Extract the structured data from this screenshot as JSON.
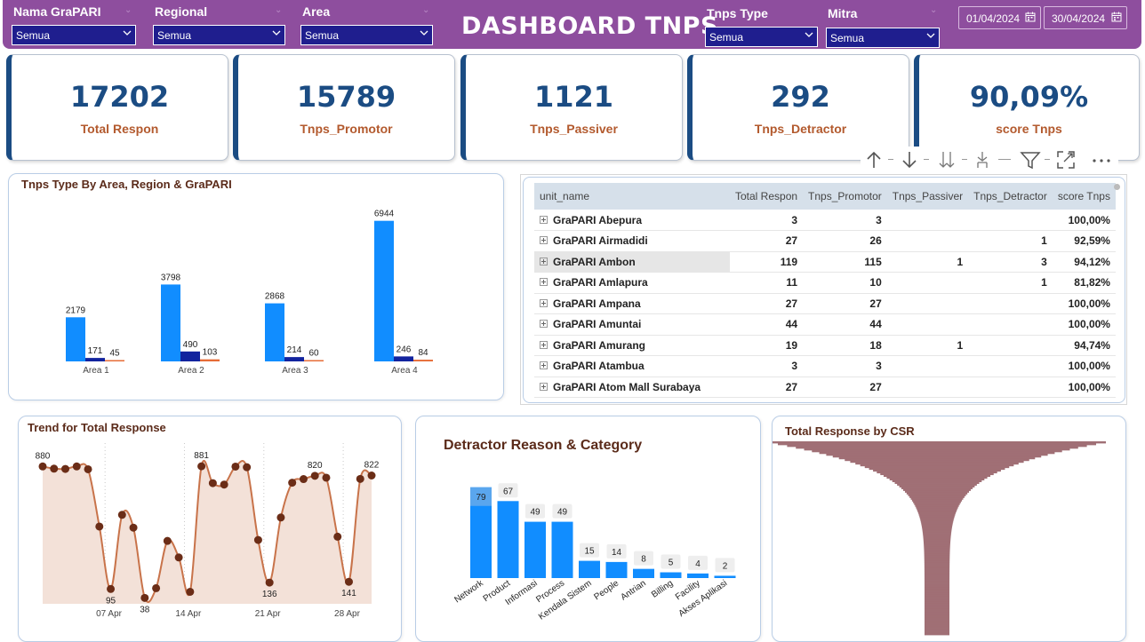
{
  "header": {
    "title": "DASHBOARD TNPS",
    "filters": [
      {
        "label": "Nama GraPARI",
        "value": "Semua"
      },
      {
        "label": "Regional",
        "value": "Semua"
      },
      {
        "label": "Area",
        "value": "Semua"
      },
      {
        "label": "Tnps Type",
        "value": "Semua"
      },
      {
        "label": "Mitra",
        "value": "Semua"
      }
    ],
    "date_start": "01/04/2024",
    "date_end": "30/04/2024"
  },
  "kpis": [
    {
      "value": "17202",
      "label": "Total Respon"
    },
    {
      "value": "15789",
      "label": "Tnps_Promotor"
    },
    {
      "value": "1121",
      "label": "Tnps_Passiver"
    },
    {
      "value": "292",
      "label": "Tnps_Detractor"
    },
    {
      "value": "90,09%",
      "label": "score Tnps"
    }
  ],
  "colors": {
    "header_bg": "#8e4e9e",
    "kpi_value": "#1b4c83",
    "kpi_label": "#b35a2e",
    "promotor": "#118dff",
    "passiver": "#12239e",
    "detractor": "#e66c37",
    "trend_line": "#c8734a",
    "trend_point": "#6b2d17",
    "trend_fill": "#f3e1d8",
    "csr_fill": "#a06f75"
  },
  "toolbar": {
    "icons": [
      "arrow-up-icon",
      "arrow-down-icon",
      "double-arrow-down-icon",
      "expand-hierarchy-icon",
      "filter-icon",
      "focus-mode-icon",
      "more-options-icon"
    ]
  },
  "area_chart": {
    "title": "Tnps Type By Area, Region & GraPARI"
  },
  "table": {
    "columns": [
      "unit_name",
      "Total Respon",
      "Tnps_Promotor",
      "Tnps_Passiver",
      "Tnps_Detractor",
      "score Tnps"
    ],
    "rows": [
      [
        "GraPARI Abepura",
        "3",
        "3",
        "",
        "",
        "100,00%"
      ],
      [
        "GraPARI Airmadidi",
        "27",
        "26",
        "",
        "1",
        "92,59%"
      ],
      [
        "GraPARI Ambon",
        "119",
        "115",
        "1",
        "3",
        "94,12%"
      ],
      [
        "GraPARI Amlapura",
        "11",
        "10",
        "",
        "1",
        "81,82%"
      ],
      [
        "GraPARI Ampana",
        "27",
        "27",
        "",
        "",
        "100,00%"
      ],
      [
        "GraPARI Amuntai",
        "44",
        "44",
        "",
        "",
        "100,00%"
      ],
      [
        "GraPARI Amurang",
        "19",
        "18",
        "1",
        "",
        "94,74%"
      ],
      [
        "GraPARI Atambua",
        "3",
        "3",
        "",
        "",
        "100,00%"
      ],
      [
        "GraPARI Atom Mall Surabaya",
        "27",
        "27",
        "",
        "",
        "100,00%"
      ]
    ]
  },
  "trend": {
    "title": "Trend for Total Response"
  },
  "detractor": {
    "title": "Detractor Reason & Category"
  },
  "csr": {
    "title": "Total Response by CSR"
  },
  "chart_data": [
    {
      "type": "bar",
      "title": "Tnps Type By Area, Region & GraPARI",
      "categories": [
        "Area 1",
        "Area 2",
        "Area 3",
        "Area 4"
      ],
      "series": [
        {
          "values": [
            2179,
            3798,
            2868,
            6944
          ]
        },
        {
          "values": [
            171,
            490,
            214,
            246
          ]
        },
        {
          "values": [
            45,
            103,
            60,
            84
          ]
        }
      ],
      "ylim": [
        0,
        7500
      ]
    },
    {
      "type": "line",
      "title": "Trend for Total Response",
      "x": [
        "01 Apr",
        "02 Apr",
        "03 Apr",
        "04 Apr",
        "05 Apr",
        "06 Apr",
        "07 Apr",
        "08 Apr",
        "09 Apr",
        "10 Apr",
        "11 Apr",
        "12 Apr",
        "13 Apr",
        "14 Apr",
        "15 Apr",
        "16 Apr",
        "17 Apr",
        "18 Apr",
        "19 Apr",
        "20 Apr",
        "21 Apr",
        "22 Apr",
        "23 Apr",
        "24 Apr",
        "25 Apr",
        "26 Apr",
        "27 Apr",
        "28 Apr",
        "29 Apr",
        "30 Apr"
      ],
      "values": [
        880,
        866,
        864,
        880,
        862,
        495,
        95,
        570,
        488,
        38,
        100,
        403,
        297,
        77,
        881,
        773,
        764,
        879,
        875,
        409,
        136,
        553,
        776,
        799,
        820,
        808,
        430,
        141,
        800,
        822
      ],
      "xticks": [
        "07 Apr",
        "14 Apr",
        "21 Apr",
        "28 Apr"
      ],
      "point_labels": {
        "0": "880",
        "6": "95",
        "9": "38",
        "14": "881",
        "20": "136",
        "24": "820",
        "27": "141",
        "29": "822"
      },
      "ylim": [
        0,
        950
      ]
    },
    {
      "type": "bar",
      "title": "Detractor Reason & Category",
      "categories": [
        "Network",
        "Product",
        "Informasi",
        "Process",
        "Kendala Sistem",
        "People",
        "Antrian",
        "Billing",
        "Facility",
        "Akses Aplikasi"
      ],
      "values": [
        79,
        67,
        49,
        49,
        15,
        14,
        8,
        5,
        4,
        2
      ],
      "ylim": [
        0,
        85
      ]
    },
    {
      "type": "area",
      "title": "Total Response by CSR",
      "shape": "funnel"
    }
  ]
}
